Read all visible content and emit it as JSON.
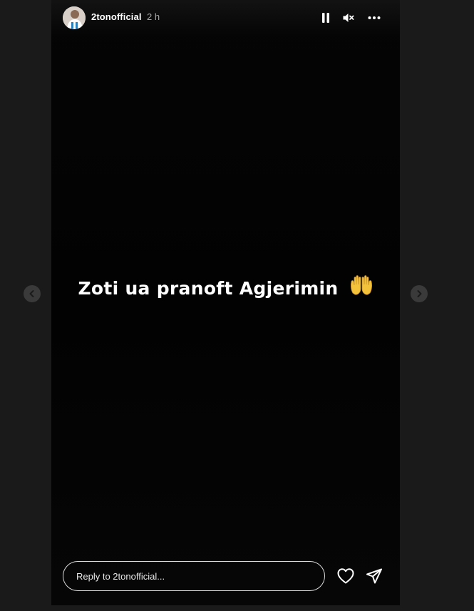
{
  "story": {
    "username": "2tonofficial",
    "timestamp": "2 h",
    "text": "Zoti ua pranoft Agjerimin",
    "emoji": "raised-hands",
    "background_color": "#030303"
  },
  "controls": {
    "pause_icon": "pause-icon",
    "mute_icon": "muted-speaker-icon",
    "more_icon": "more-options-icon"
  },
  "reply": {
    "placeholder": "Reply to 2tonofficial..."
  },
  "actions": {
    "like_icon": "heart-icon",
    "share_icon": "paper-plane-icon"
  },
  "navigation": {
    "prev_icon": "chevron-left-icon",
    "next_icon": "chevron-right-icon"
  },
  "colors": {
    "page_bg": "#1a1a1a",
    "nav_button_bg": "#3a3a3a",
    "emoji_yellow": "#f5c33b",
    "text_white": "#ffffff",
    "timestamp_gray": "#a8a8a8"
  }
}
